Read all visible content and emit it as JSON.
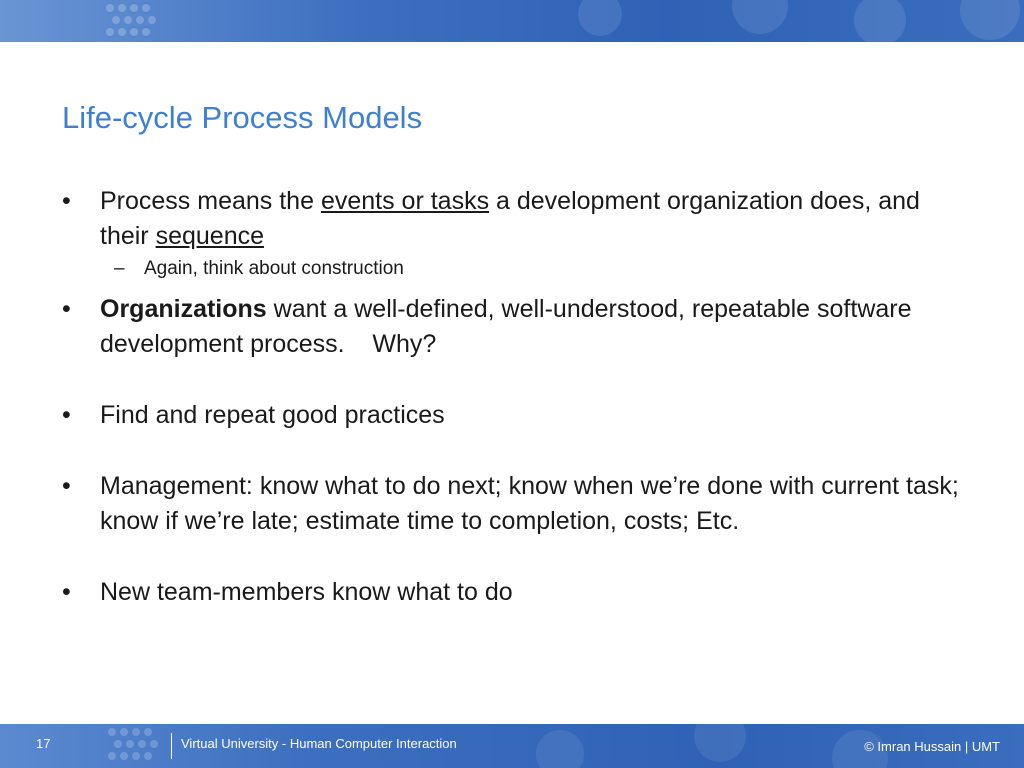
{
  "slide": {
    "title": "Life-cycle Process Models"
  },
  "bullets": {
    "b1": {
      "mark": "•",
      "text_a": "Process means the ",
      "u1": "events or tasks",
      "text_b": " a development organization does, and their ",
      "u2": "sequence"
    },
    "s1": {
      "mark": "–",
      "text": "Again, think about construction"
    },
    "b2": {
      "mark": "•",
      "bold": "Organizations",
      "text": " want a well-defined, well-understood, repeatable software development process.    Why?"
    },
    "b3": {
      "mark": "•",
      "text": "Find and repeat good practices"
    },
    "b4": {
      "mark": "•",
      "text": "Management: know what to do next; know when we’re done with current task; know if we’re late; estimate time to completion, costs; Etc."
    },
    "b5": {
      "mark": "•",
      "text": "New team-members know what to do"
    }
  },
  "footer": {
    "page_number": "17",
    "course": "Virtual University - Human Computer Interaction",
    "copyright": "© Imran Hussain | UMT"
  },
  "colors": {
    "title": "#3f7fd0",
    "band": "#3d6fc0"
  }
}
